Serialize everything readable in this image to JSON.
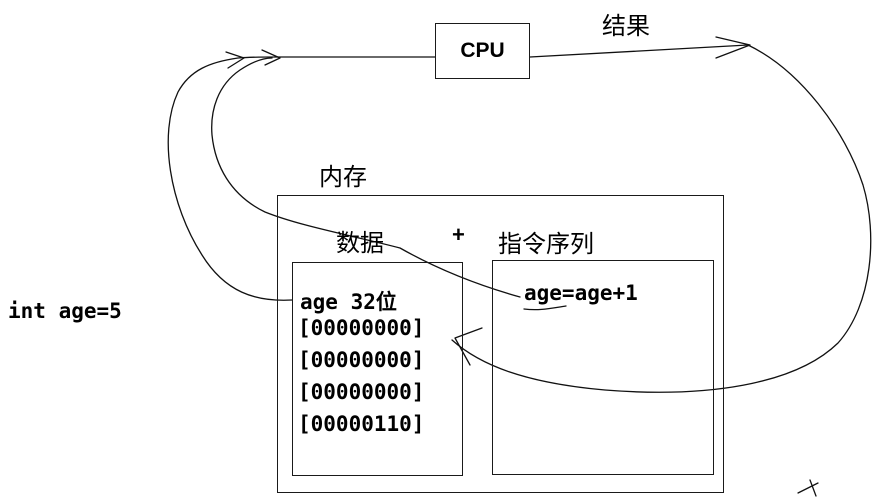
{
  "cpu": {
    "label": "CPU"
  },
  "result_label": "结果",
  "memory": {
    "title": "内存",
    "data_title": "数据",
    "plus": "+",
    "instr_title": "指令序列",
    "data_header": "age 32位",
    "data_bytes": [
      "[00000000]",
      "[00000000]",
      "[00000000]",
      "[00000110]"
    ],
    "instruction": "age=age+1"
  },
  "declaration": "int age=5",
  "colors": {
    "ink": "#000000",
    "box_border": "#1a1a1a",
    "background": "#ffffff"
  }
}
